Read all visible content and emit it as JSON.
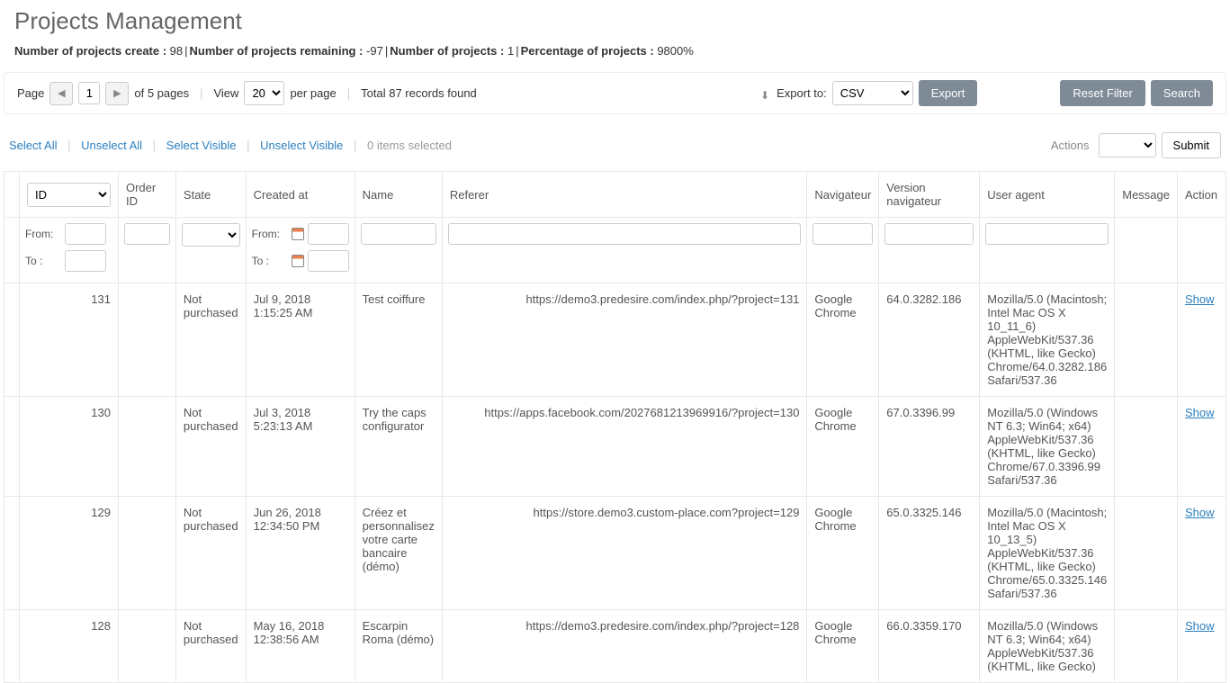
{
  "title": "Projects Management",
  "stats": {
    "create_label": "Number of projects create :",
    "create_value": "98",
    "remaining_label": "Number of projects remaining :",
    "remaining_value": "-97",
    "count_label": "Number of projects :",
    "count_value": "1",
    "pct_label": "Percentage of projects :",
    "pct_value": "9800%"
  },
  "pager": {
    "page_label": "Page",
    "page_value": "1",
    "of_pages": "of 5 pages",
    "view_label": "View",
    "per_page_value": "20",
    "per_page_label": "per page",
    "total_label": "Total 87 records found"
  },
  "export": {
    "label": "Export to:",
    "format": "CSV",
    "button": "Export"
  },
  "buttons": {
    "reset": "Reset Filter",
    "search": "Search",
    "submit": "Submit"
  },
  "selection": {
    "select_all": "Select All",
    "unselect_all": "Unselect All",
    "select_visible": "Select Visible",
    "unselect_visible": "Unselect Visible",
    "items_selected": "0 items selected",
    "actions_label": "Actions"
  },
  "columns": {
    "id": "ID",
    "order_id": "Order ID",
    "state": "State",
    "created_at": "Created at",
    "name": "Name",
    "referer": "Referer",
    "navigateur": "Navigateur",
    "version": "Version navigateur",
    "ua": "User agent",
    "message": "Message",
    "action": "Action"
  },
  "filter_labels": {
    "from": "From:",
    "to": "To :"
  },
  "rows": [
    {
      "id": "131",
      "state": "Not purchased",
      "created": "Jul 9, 2018 1:15:25 AM",
      "name": "Test coiffure",
      "referer": "https://demo3.predesire.com/index.php/?project=131",
      "nav": "Google Chrome",
      "ver": "64.0.3282.186",
      "ua": "Mozilla/5.0 (Macintosh; Intel Mac OS X 10_11_6) AppleWebKit/537.36 (KHTML, like Gecko) Chrome/64.0.3282.186 Safari/537.36",
      "action": "Show"
    },
    {
      "id": "130",
      "state": "Not purchased",
      "created": "Jul 3, 2018 5:23:13 AM",
      "name": "Try the caps configurator",
      "referer": "https://apps.facebook.com/2027681213969916/?project=130",
      "nav": "Google Chrome",
      "ver": "67.0.3396.99",
      "ua": "Mozilla/5.0 (Windows NT 6.3; Win64; x64) AppleWebKit/537.36 (KHTML, like Gecko) Chrome/67.0.3396.99 Safari/537.36",
      "action": "Show"
    },
    {
      "id": "129",
      "state": "Not purchased",
      "created": "Jun 26, 2018 12:34:50 PM",
      "name": "Créez et personnalisez votre carte bancaire (démo)",
      "referer": "https://store.demo3.custom-place.com?project=129",
      "nav": "Google Chrome",
      "ver": "65.0.3325.146",
      "ua": "Mozilla/5.0 (Macintosh; Intel Mac OS X 10_13_5) AppleWebKit/537.36 (KHTML, like Gecko) Chrome/65.0.3325.146 Safari/537.36",
      "action": "Show"
    },
    {
      "id": "128",
      "state": "Not purchased",
      "created": "May 16, 2018 12:38:56 AM",
      "name": "Escarpin Roma (démo)",
      "referer": "https://demo3.predesire.com/index.php/?project=128",
      "nav": "Google Chrome",
      "ver": "66.0.3359.170",
      "ua": "Mozilla/5.0 (Windows NT 6.3; Win64; x64) AppleWebKit/537.36 (KHTML, like Gecko)",
      "action": "Show"
    }
  ]
}
